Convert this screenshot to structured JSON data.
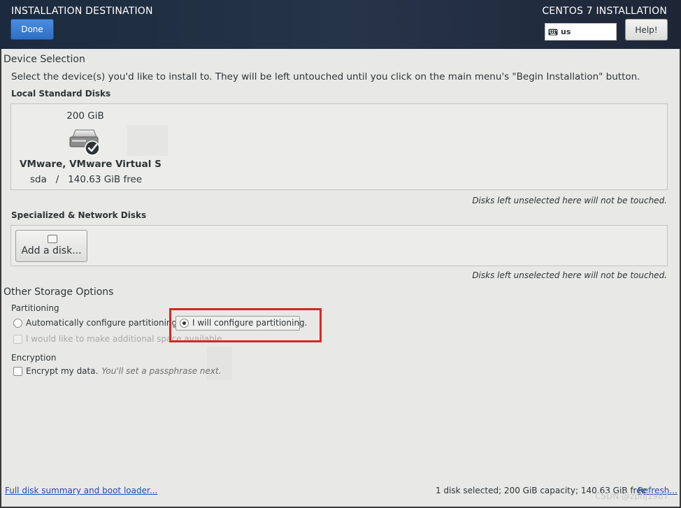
{
  "header": {
    "spoke_title": "INSTALLATION DESTINATION",
    "done_label": "Done",
    "product_title": "CENTOS 7 INSTALLATION",
    "keyboard_layout": "us",
    "help_label": "Help!",
    "colors": {
      "header_bg": "#1c2a3d",
      "done_btn": "#3b7dd8"
    }
  },
  "device_selection": {
    "title": "Device Selection",
    "instructions": "Select the device(s) you'd like to install to.  They will be left untouched until you click on the main menu's \"Begin Installation\" button.",
    "local_label": "Local Standard Disks",
    "disks": [
      {
        "size": "200 GiB",
        "name": "VMware, VMware Virtual S",
        "device_free": "sda   /   140.63 GiB free",
        "icon": "hard-disk-icon",
        "selected": true
      }
    ],
    "local_note": "Disks left unselected here will not be touched.",
    "specialized_label": "Specialized & Network Disks",
    "add_disk_label": "Add a disk...",
    "specialized_note": "Disks left unselected here will not be touched."
  },
  "other_storage": {
    "title": "Other Storage Options",
    "partitioning_label": "Partitioning",
    "auto_label": "Automatically configure partitioning.",
    "manual_label": "I will configure partitioning.",
    "selected": "manual",
    "extra_space_label": "I would like to make additional space available.",
    "encryption_label": "Encryption",
    "encrypt_label": "Encrypt my data.",
    "encrypt_hint": "You'll set a passphrase next."
  },
  "footer": {
    "summary_link": "Full disk summary and boot loader...",
    "status": "1 disk selected; 200 GiB capacity; 140.63 GiB free",
    "refresh_link": "Refresh..."
  },
  "watermark": "CSDN @zpnj1987",
  "annotation_color": "#d9261c"
}
